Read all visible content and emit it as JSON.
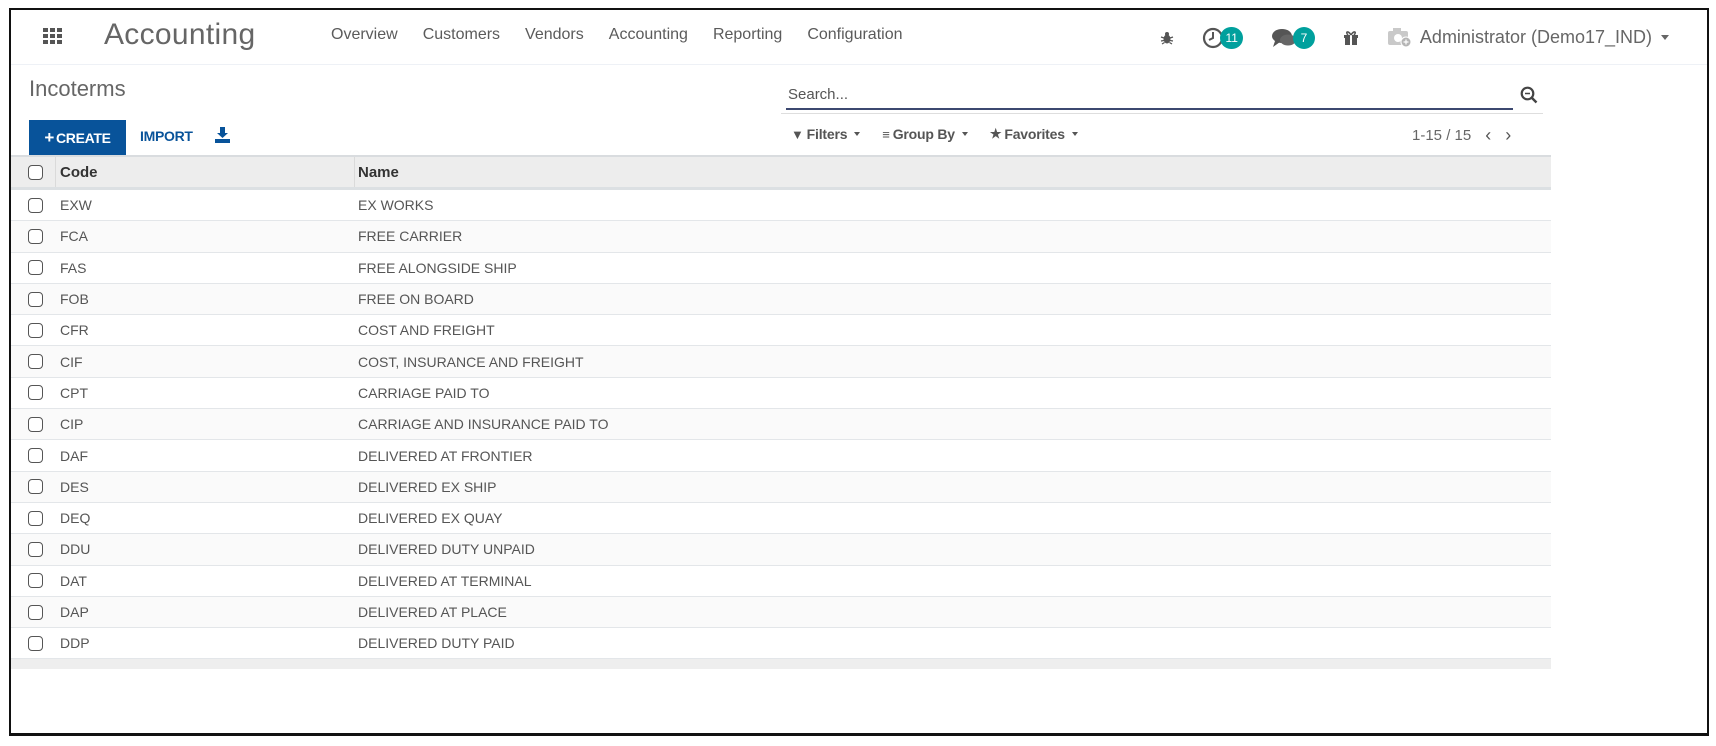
{
  "navbar": {
    "app_title": "Accounting",
    "menu": [
      "Overview",
      "Customers",
      "Vendors",
      "Accounting",
      "Reporting",
      "Configuration"
    ],
    "activity_count": "11",
    "messages_count": "7",
    "user_label": "Administrator (Demo17_IND)",
    "badge_color": "#00a09d"
  },
  "control_panel": {
    "title": "Incoterms",
    "create_label": "CREATE",
    "import_label": "IMPORT",
    "search_placeholder": "Search...",
    "filters_label": "Filters",
    "group_by_label": "Group By",
    "favorites_label": "Favorites",
    "pager_value": "1-15 / 15",
    "primary_color": "#08539a"
  },
  "table": {
    "columns": [
      "Code",
      "Name"
    ],
    "rows": [
      {
        "code": "EXW",
        "name": "EX WORKS"
      },
      {
        "code": "FCA",
        "name": "FREE CARRIER"
      },
      {
        "code": "FAS",
        "name": "FREE ALONGSIDE SHIP"
      },
      {
        "code": "FOB",
        "name": "FREE ON BOARD"
      },
      {
        "code": "CFR",
        "name": "COST AND FREIGHT"
      },
      {
        "code": "CIF",
        "name": "COST, INSURANCE AND FREIGHT"
      },
      {
        "code": "CPT",
        "name": "CARRIAGE PAID TO"
      },
      {
        "code": "CIP",
        "name": "CARRIAGE AND INSURANCE PAID TO"
      },
      {
        "code": "DAF",
        "name": "DELIVERED AT FRONTIER"
      },
      {
        "code": "DES",
        "name": "DELIVERED EX SHIP"
      },
      {
        "code": "DEQ",
        "name": "DELIVERED EX QUAY"
      },
      {
        "code": "DDU",
        "name": "DELIVERED DUTY UNPAID"
      },
      {
        "code": "DAT",
        "name": "DELIVERED AT TERMINAL"
      },
      {
        "code": "DAP",
        "name": "DELIVERED AT PLACE"
      },
      {
        "code": "DDP",
        "name": "DELIVERED DUTY PAID"
      }
    ]
  }
}
